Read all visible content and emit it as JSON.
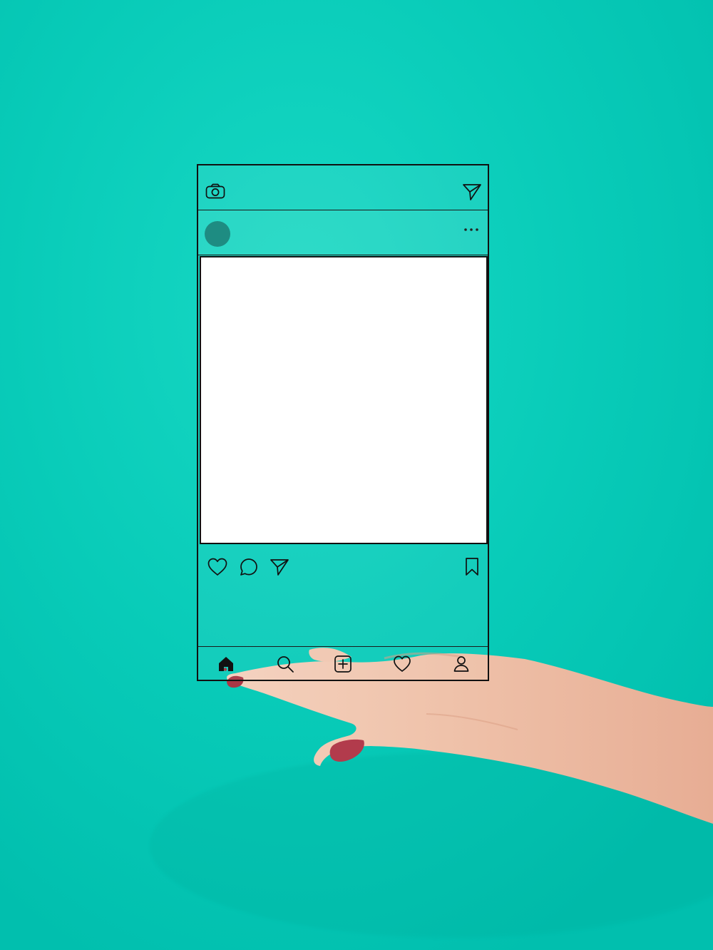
{
  "scene": {
    "background_color": "#08ccb9",
    "frame_color": "#111111",
    "image_area_color": "#ffffff"
  },
  "top_bar": {
    "left_icon": "camera-icon",
    "right_icon": "send-icon"
  },
  "post_header": {
    "avatar_color": "#1e8c82",
    "menu_icon": "more-icon"
  },
  "post": {
    "image_placeholder": ""
  },
  "actions": {
    "icons": [
      "heart-icon",
      "comment-icon",
      "send-icon",
      "bookmark-icon"
    ]
  },
  "bottom_nav": {
    "items": [
      {
        "icon": "home-icon",
        "active": true
      },
      {
        "icon": "search-icon",
        "active": false
      },
      {
        "icon": "add-post-icon",
        "active": false
      },
      {
        "icon": "heart-icon",
        "active": false
      },
      {
        "icon": "profile-icon",
        "active": false
      }
    ]
  }
}
